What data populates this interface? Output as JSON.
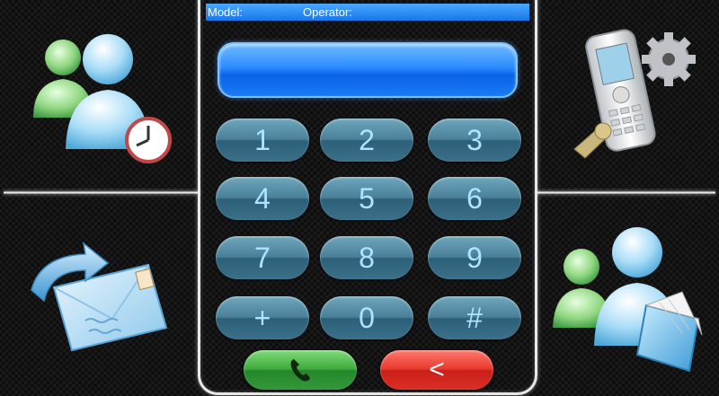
{
  "status_bar": {
    "model_label": "Model:",
    "operator_label": "Operator:"
  },
  "display": {
    "value": ""
  },
  "keypad": {
    "keys": [
      "1",
      "2",
      "3",
      "4",
      "5",
      "6",
      "7",
      "8",
      "9",
      "+",
      "0",
      "#"
    ]
  },
  "actions": {
    "call_icon": "phone-handset-icon",
    "back_label": "<"
  },
  "quadrants": {
    "top_left_icon": "contacts-history-icon",
    "bottom_left_icon": "reply-message-icon",
    "top_right_icon": "phone-settings-icon",
    "bottom_right_icon": "contacts-book-icon"
  }
}
